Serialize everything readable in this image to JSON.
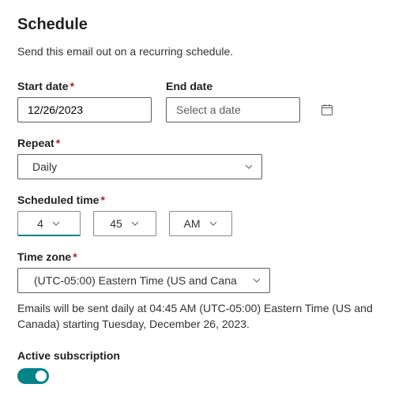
{
  "title": "Schedule",
  "subtitle": "Send this email out on a recurring schedule.",
  "start_date": {
    "label": "Start date",
    "required": true,
    "value": "12/26/2023"
  },
  "end_date": {
    "label": "End date",
    "required": false,
    "placeholder": "Select a date",
    "value": ""
  },
  "repeat": {
    "label": "Repeat",
    "required": true,
    "value": "Daily"
  },
  "scheduled_time": {
    "label": "Scheduled time",
    "required": true,
    "hour": "4",
    "minute": "45",
    "ampm": "AM"
  },
  "timezone": {
    "label": "Time zone",
    "required": true,
    "value": "(UTC-05:00) Eastern Time (US and Cana"
  },
  "summary": "Emails will be sent daily at 04:45 AM (UTC-05:00) Eastern Time (US and Canada) starting Tuesday, December 26, 2023.",
  "active_subscription": {
    "label": "Active subscription",
    "on": true
  }
}
